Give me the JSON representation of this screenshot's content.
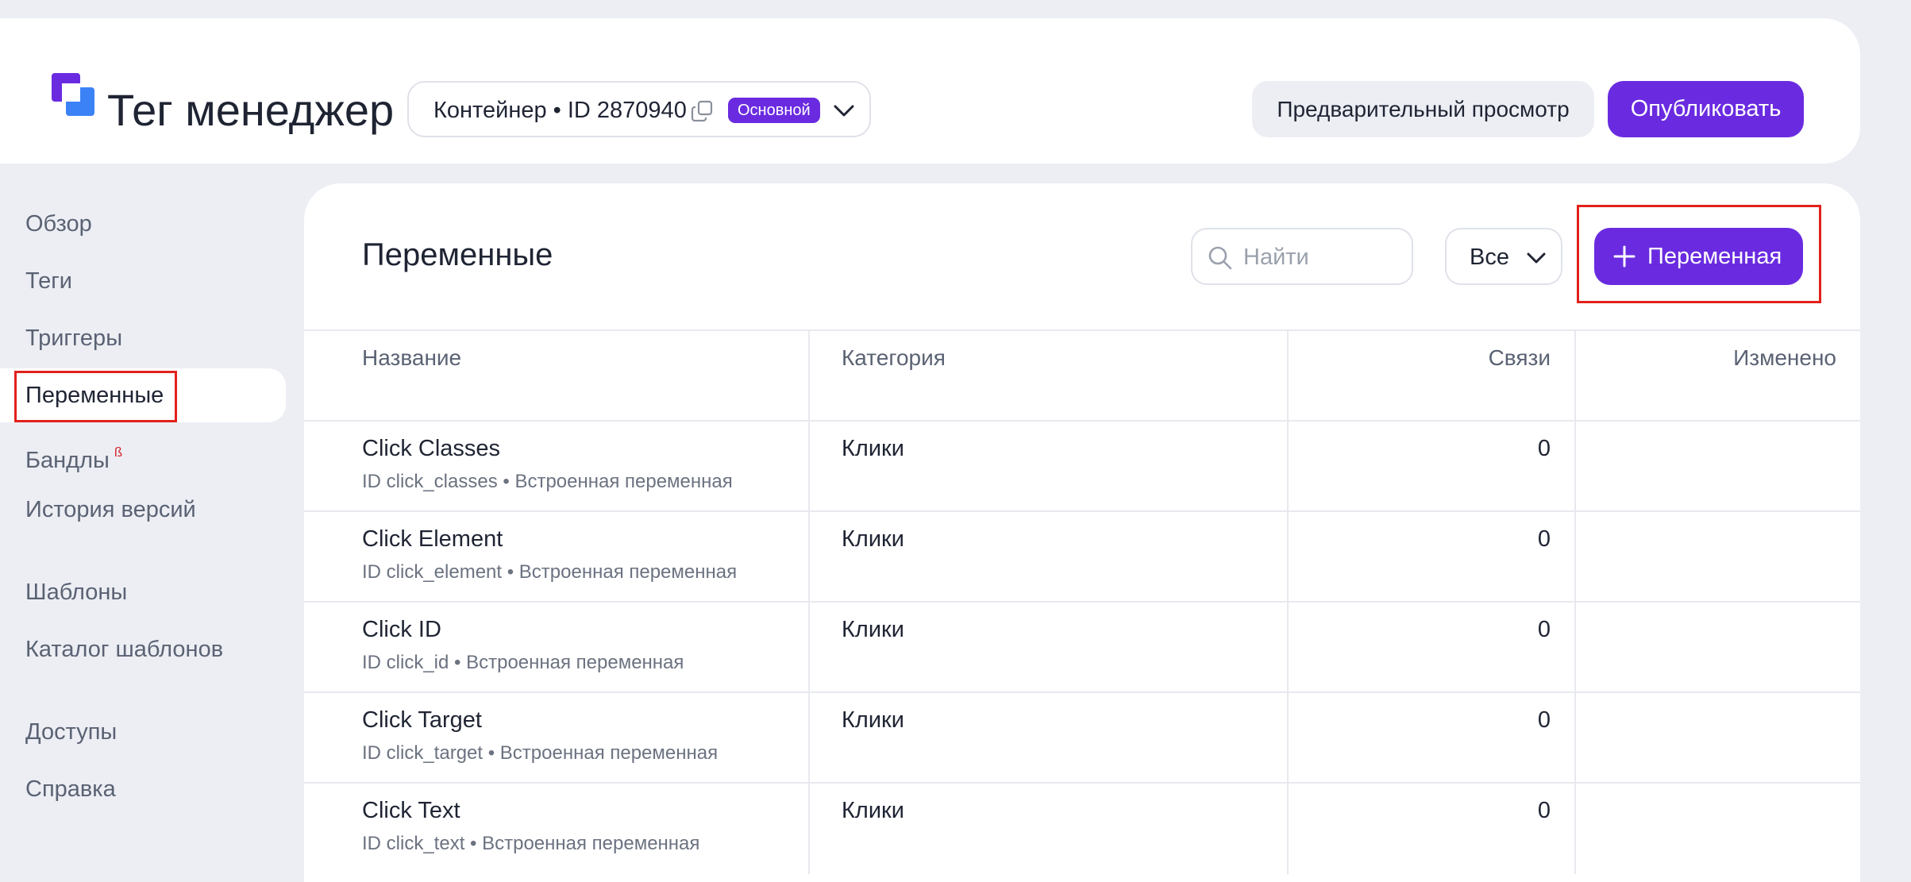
{
  "header": {
    "app_title": "Тег менеджер",
    "container_label": "Контейнер • ID 2870940",
    "container_badge": "Основной",
    "preview_label": "Предварительный просмотр",
    "publish_label": "Опубликовать"
  },
  "sidebar": {
    "items": [
      {
        "label": "Обзор"
      },
      {
        "label": "Теги"
      },
      {
        "label": "Триггеры"
      },
      {
        "label": "Переменные",
        "active": true
      },
      {
        "label": "Бандлы",
        "badge": "ß"
      },
      {
        "label": "История версий"
      },
      {
        "label": "Шаблоны"
      },
      {
        "label": "Каталог шаблонов"
      },
      {
        "label": "Доступы"
      },
      {
        "label": "Справка"
      }
    ]
  },
  "main": {
    "title": "Переменные",
    "search_placeholder": "Найти",
    "filter_value": "Все",
    "add_label": "Переменная",
    "columns": [
      "Название",
      "Категория",
      "Связи",
      "Изменено"
    ],
    "rows": [
      {
        "name": "Click Classes",
        "sub": "ID click_classes • Встроенная переменная",
        "category": "Клики",
        "links": "0"
      },
      {
        "name": "Click Element",
        "sub": "ID click_element • Встроенная переменная",
        "category": "Клики",
        "links": "0"
      },
      {
        "name": "Click ID",
        "sub": "ID click_id • Встроенная переменная",
        "category": "Клики",
        "links": "0"
      },
      {
        "name": "Click Target",
        "sub": "ID click_target • Встроенная переменная",
        "category": "Клики",
        "links": "0"
      },
      {
        "name": "Click Text",
        "sub": "ID click_text • Встроенная переменная",
        "category": "Клики",
        "links": "0"
      }
    ]
  },
  "colors": {
    "accent": "#6a2be0",
    "logo_purple": "#6a2be0",
    "logo_blue": "#3b82f6",
    "highlight": "#e2211c",
    "background": "#eceef4"
  }
}
